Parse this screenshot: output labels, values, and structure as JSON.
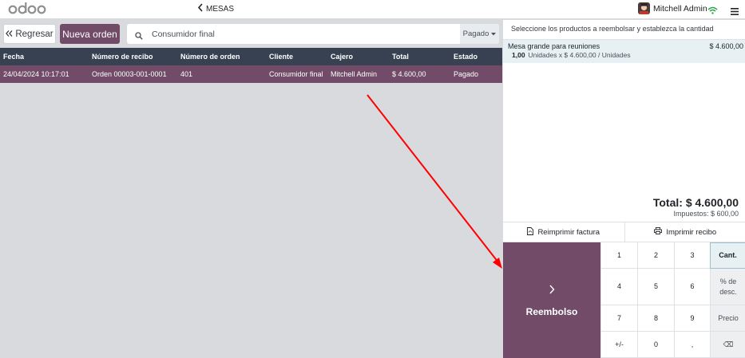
{
  "topbar": {
    "logo_text": "odoo",
    "back_label": "MESAS",
    "user_name": "Mitchell Admin",
    "icons": [
      "chevron-left-icon",
      "wifi-icon",
      "menu-icon"
    ],
    "wifi_color": "#28a745"
  },
  "toolbar": {
    "back_label": "Regresar",
    "new_order_label": "Nueva orden",
    "search_value": "Consumidor final",
    "filter_label": "Pagado"
  },
  "table": {
    "headers": [
      "Fecha",
      "Número de recibo",
      "Número de orden",
      "Cliente",
      "Cajero",
      "Total",
      "Estado"
    ],
    "rows": [
      [
        "24/04/2024 10:17:01",
        "Orden 00003-001-0001",
        "401",
        "Consumidor final",
        "Mitchell Admin",
        "$ 4.600,00",
        "Pagado"
      ]
    ]
  },
  "refund_panel": {
    "instructions": "Seleccione los productos a reembolsar y establezca la cantidad",
    "orderline": {
      "product": "Mesa grande para reuniones",
      "price": "$ 4.600,00",
      "qty": "1,00",
      "detail": "Unidades x $ 4.600,00 / Unidades"
    },
    "total": "Total: $ 4.600,00",
    "taxes": "Impuestos: $ 600,00",
    "reprint_invoice_label": "Reimprimir factura",
    "print_receipt_label": "Imprimir recibo",
    "refund_label": "Reembolso"
  },
  "numpad": {
    "keys": [
      "1",
      "2",
      "3",
      "4",
      "5",
      "6",
      "7",
      "8",
      "9",
      "+/-",
      "0",
      ","
    ],
    "mode_qty": "Cant.",
    "mode_disc_line1": "% de",
    "mode_disc_line2": "desc.",
    "mode_price": "Precio",
    "backspace": "⌫"
  },
  "colors": {
    "brand": "#714b67",
    "header_dark": "#374151",
    "background": "#d9dadd",
    "selected_line": "#e7f1f4",
    "annotation_arrow": "#ff0000"
  }
}
